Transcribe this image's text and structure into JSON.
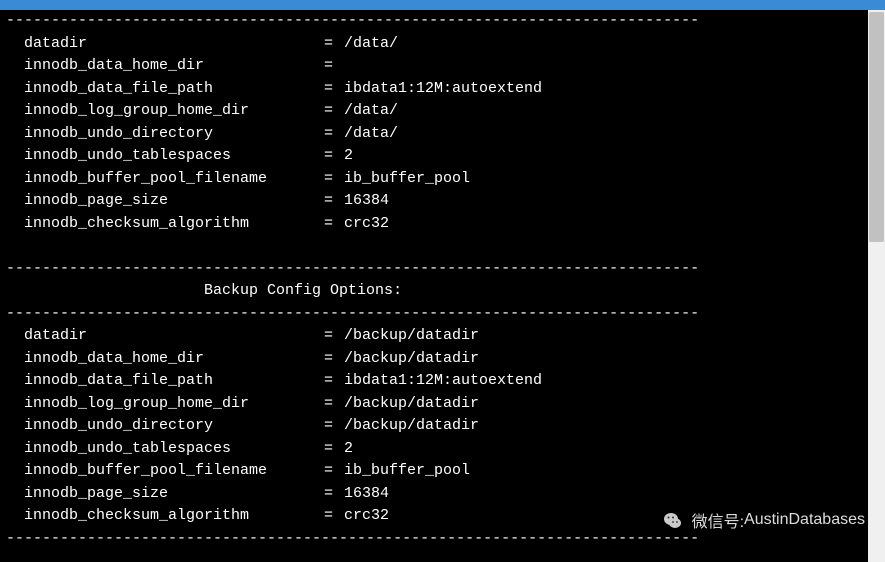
{
  "divider": "-----------------------------------------------------------------------------",
  "section1": {
    "rows": [
      {
        "key": "datadir",
        "value": "/data/"
      },
      {
        "key": "innodb_data_home_dir",
        "value": ""
      },
      {
        "key": "innodb_data_file_path",
        "value": "ibdata1:12M:autoextend"
      },
      {
        "key": "innodb_log_group_home_dir",
        "value": "/data/"
      },
      {
        "key": "innodb_undo_directory",
        "value": "/data/"
      },
      {
        "key": "innodb_undo_tablespaces",
        "value": "2"
      },
      {
        "key": "innodb_buffer_pool_filename",
        "value": "ib_buffer_pool"
      },
      {
        "key": "innodb_page_size",
        "value": "16384"
      },
      {
        "key": "innodb_checksum_algorithm",
        "value": "crc32"
      }
    ]
  },
  "section2_title": "                      Backup Config Options:",
  "section2": {
    "rows": [
      {
        "key": "datadir",
        "value": "/backup/datadir"
      },
      {
        "key": "innodb_data_home_dir",
        "value": "/backup/datadir"
      },
      {
        "key": "innodb_data_file_path",
        "value": "ibdata1:12M:autoextend"
      },
      {
        "key": "innodb_log_group_home_dir",
        "value": "/backup/datadir"
      },
      {
        "key": "innodb_undo_directory",
        "value": "/backup/datadir"
      },
      {
        "key": "innodb_undo_tablespaces",
        "value": "2"
      },
      {
        "key": "innodb_buffer_pool_filename",
        "value": "ib_buffer_pool"
      },
      {
        "key": "innodb_page_size",
        "value": "16384"
      },
      {
        "key": "innodb_checksum_algorithm",
        "value": "crc32"
      }
    ]
  },
  "eq": "= ",
  "pad": "  ",
  "blank": " ",
  "watermark": {
    "label": "微信号:",
    "value": " AustinDatabases"
  }
}
